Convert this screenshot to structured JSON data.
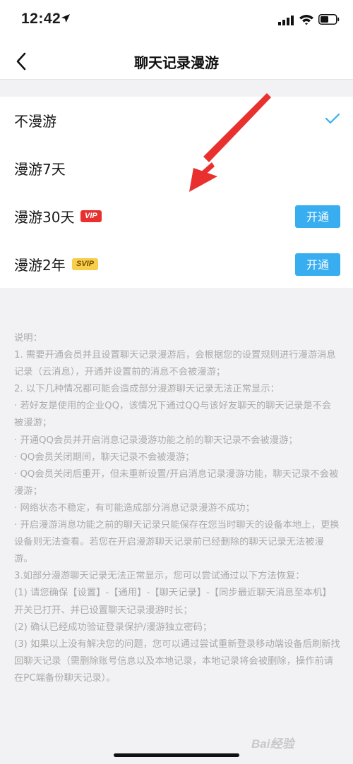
{
  "status_bar": {
    "time": "12:42",
    "icons": [
      "location-arrow-icon",
      "cellular-signal-icon",
      "wifi-icon",
      "battery-icon"
    ]
  },
  "nav": {
    "title": "聊天记录漫游",
    "back_icon": "chevron-left-icon"
  },
  "options": [
    {
      "label": "不漫游",
      "selected": true
    },
    {
      "label": "漫游7天"
    },
    {
      "label": "漫游30天",
      "badge": "VIP",
      "button": "开通"
    },
    {
      "label": "漫游2年",
      "badge": "SVIP",
      "button": "开通"
    }
  ],
  "notes": {
    "lines": [
      "说明：",
      "1. 需要开通会员并且设置聊天记录漫游后，会根据您的设置规则进行漫游消息记录（云消息），开通并设置前的消息不会被漫游；",
      "2. 以下几种情况都可能会造成部分漫游聊天记录无法正常显示：",
      "· 若好友是使用的企业QQ，该情况下通过QQ与该好友聊天的聊天记录是不会被漫游；",
      "· 开通QQ会员并开启消息记录漫游功能之前的聊天记录不会被漫游；",
      "· QQ会员关闭期间，聊天记录不会被漫游；",
      "· QQ会员关闭后重开，但未重新设置/开启消息记录漫游功能，聊天记录不会被漫游；",
      "· 网络状态不稳定，有可能造成部分消息记录漫游不成功；",
      "· 开启漫游消息功能之前的聊天记录只能保存在您当时聊天的设备本地上，更换设备则无法查看。若您在开启漫游聊天记录前已经删除的聊天记录无法被漫游。",
      "3.如部分漫游聊天记录无法正常显示，您可以尝试通过以下方法恢复：",
      "(1) 请您确保【设置】-【通用】-【聊天记录】-【同步最近聊天消息至本机】开关已打开、并已设置聊天记录漫游时长；",
      "(2) 确认已经成功验证登录保护/漫游独立密码；",
      "(3) 如果以上没有解决您的问题，您可以通过尝试重新登录移动端设备后刷新找回聊天记录（需删除账号信息以及本地记录，本地记录将会被删除，操作前请在PC端备份聊天记录）。"
    ]
  },
  "watermark": "Bai经验",
  "colors": {
    "accent": "#38adf0",
    "vip_badge": "#e8312f",
    "svip_badge": "#f7cf4a",
    "annotation_arrow": "#e8312f",
    "note_text": "#aaaaaa"
  }
}
